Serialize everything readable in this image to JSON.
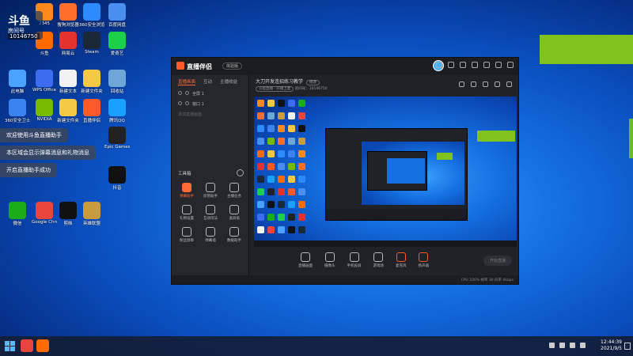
{
  "desktop": {
    "logo": {
      "line1": "斗鱼",
      "line2": "房间号",
      "line3": "10146750"
    },
    "icons": [
      {
        "label": "2345",
        "color": "#ff8a1c"
      },
      {
        "label": "搜狗浏览器",
        "color": "#ff6e2a"
      },
      {
        "label": "360安全浏览器",
        "color": "#2c8cff"
      },
      {
        "label": "百度网盘",
        "color": "#4a8ef0"
      },
      {
        "label": "斗鱼",
        "color": "#ff6b00"
      },
      {
        "label": "网易云",
        "color": "#e5322d"
      },
      {
        "label": "Steam",
        "color": "#1b2838"
      },
      {
        "label": "爱奇艺",
        "color": "#1dd04a"
      },
      {
        "label": "此电脑",
        "color": "#4aa3ff"
      },
      {
        "label": "WPS Office",
        "color": "#3c6cf0"
      },
      {
        "label": "新建文本",
        "color": "#f2f2f2"
      },
      {
        "label": "新建文件夹",
        "color": "#f6c945"
      },
      {
        "label": "回收站",
        "color": "#6fa6d8"
      },
      {
        "label": "360安全卫士",
        "color": "#3a83f0"
      },
      {
        "label": "NVIDIA",
        "color": "#76b900"
      },
      {
        "label": "新建文件夹",
        "color": "#f6c945"
      },
      {
        "label": "直播伴侣",
        "color": "#ff5a2a"
      },
      {
        "label": "腾讯QQ",
        "color": "#1aa0ff"
      },
      {
        "label": "Epic Games",
        "color": "#222222"
      },
      {
        "label": "抖音",
        "color": "#111111"
      },
      {
        "label": "微信",
        "color": "#1aad19"
      },
      {
        "label": "Google Chrome",
        "color": "#e8453c"
      },
      {
        "label": "剪映",
        "color": "#111111"
      },
      {
        "label": "英雄联盟",
        "color": "#c89b3c"
      }
    ],
    "toasts": [
      "欢迎使用斗鱼直播助手",
      "本区域会显示弹幕消息和礼物消息",
      "开启直播助手成功"
    ]
  },
  "app": {
    "brand": "直播伴侣",
    "version": "体验版",
    "left_tabs": [
      "直播画面",
      "互动",
      "主播收益"
    ],
    "scenes": [
      "全屏 1",
      "窗口 1"
    ],
    "add_scene": "添加直播画面",
    "toolbox_title": "工具箱",
    "tools": [
      {
        "label": "弹幕助手",
        "hot": true
      },
      {
        "label": "房管助手",
        "hot": false
      },
      {
        "label": "主播任务",
        "hot": false
      },
      {
        "label": "礼物设置",
        "hot": false
      },
      {
        "label": "互动玩法",
        "hot": false
      },
      {
        "label": "道具墙",
        "hot": false
      },
      {
        "label": "粉丝勋章",
        "hot": false
      },
      {
        "label": "弹幕墙",
        "hot": false
      },
      {
        "label": "数据助手",
        "hot": false
      }
    ],
    "room_title": "大刀开发连招练习教学",
    "room_badge": "修改",
    "room_sub_pill": "斗鱼直播 · 开播上麦",
    "room_id": "房间号：10146750",
    "bottom_tools": [
      "直播画面",
      "摄像头",
      "手机投屏",
      "游戏场",
      "麦克风",
      "扬声器"
    ],
    "start_live": "开始直播",
    "status_left": "",
    "status_right": "CPU 100%  帧率 30  码率 0kbps"
  },
  "taskbar": {
    "time": "12:44:39",
    "date": "2021/9/5"
  }
}
